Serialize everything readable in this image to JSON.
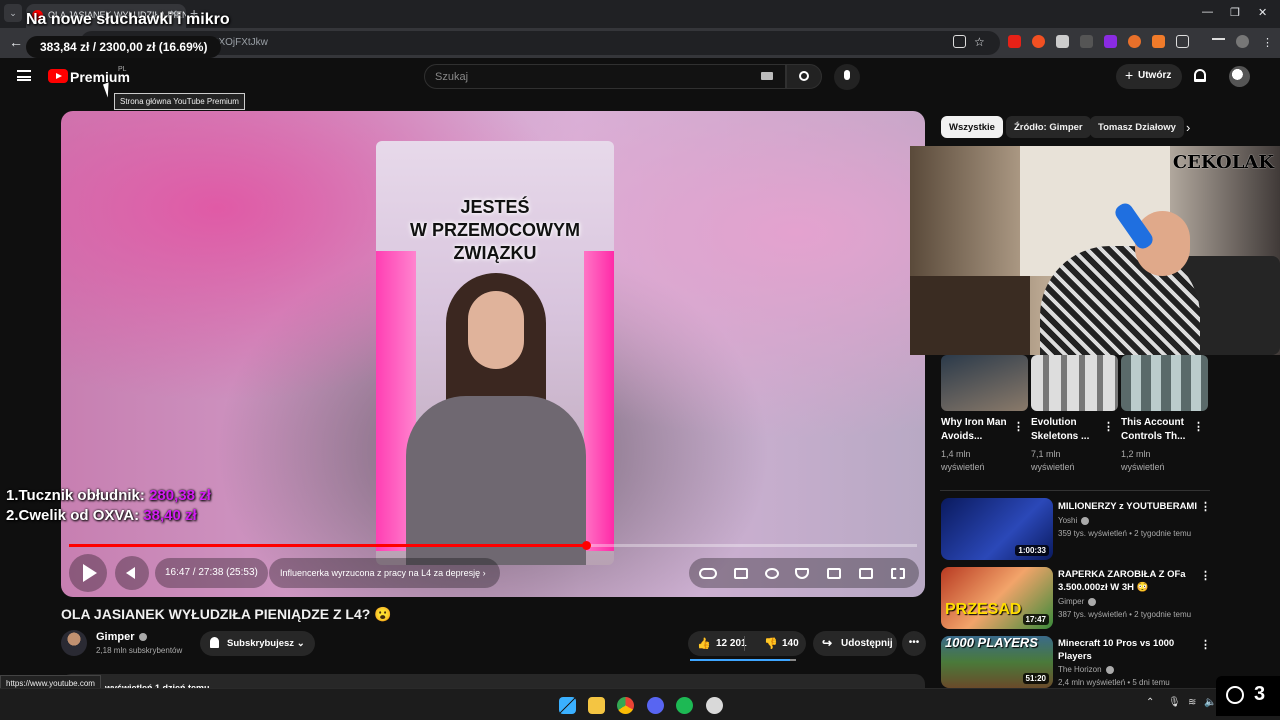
{
  "overlay": {
    "stream_title": "Na nowe słuchawki i mikro",
    "goal": "383,84 zł / 2300,00 zł (16.69%)",
    "goal_progress_percent": 16.69,
    "lines": [
      {
        "label": "1.Tucznik obłudnik:",
        "amount": "280,38 zł"
      },
      {
        "label": "2.Cwelik od OXVA:",
        "amount": "38,40 zł"
      }
    ],
    "viewers": "3",
    "webcam_logo": "CEKOLAK"
  },
  "browser": {
    "tab_title": "OLA JASIANEK WYŁUDZIŁA PIENIĄDZE",
    "url": "youtube.com/watch?v=...9XOjFXtJkw",
    "status_url": "https://www.youtube.com"
  },
  "header": {
    "logo": "Premium",
    "logo_region": "PL",
    "tooltip": "Strona główna YouTube Premium",
    "search_placeholder": "Szukaj",
    "create_label": "Utwórz"
  },
  "player": {
    "frame_text": "JESTEŚ\nW PRZEMOCOWYM\nZWIĄZKU",
    "time": "16:47 / 27:38 (25:53)",
    "chapter": "Influencerka wyrzucona z pracy na L4 za depresję",
    "progress_fraction": 0.61
  },
  "video": {
    "title": "OLA JASIANEK WYŁUDZIŁA PIENIĄDZE Z L4? 😮",
    "channel": "Gimper",
    "subscribers": "2,18 mln subskrybentów",
    "subscribe_label": "Subskrybujesz",
    "likes": "12 201",
    "dislikes": "140",
    "share_label": "Udostępnij",
    "description_preview": "wyświetleń  1 dzień temu"
  },
  "sidebar": {
    "chips": [
      "Wszystkie",
      "Źródło: Gimper",
      "Tomasz Działowy"
    ],
    "shorts": [
      {
        "title": "Why Iron Man Avoids...",
        "views": "1,4 mln wyświetleń"
      },
      {
        "title": "Evolution Skeletons ...",
        "views": "7,1 mln wyświetleń"
      },
      {
        "title": "This Account Controls Th...",
        "views": "1,2 mln wyświetleń"
      }
    ],
    "recommended": [
      {
        "title": "MILIONERZY z YOUTUBERAMI",
        "channel": "Yoshi",
        "meta": "359 tys. wyświetleń • 2 tygodnie temu",
        "duration": "1:00:33",
        "color": "#1a2a6e"
      },
      {
        "title": "RAPERKA ZAROBIŁA Z OFa 3.500.000zł W 3H 😳",
        "channel": "Gimper",
        "meta": "387 tys. wyświetleń • 2 tygodnie temu",
        "duration": "17:47",
        "color": "#c44a2e",
        "thumb_text": "PRZESAD"
      },
      {
        "title": "Minecraft 10 Pros vs 1000 Players",
        "channel": "The Horizon",
        "meta": "2,4 mln wyświetleń • 5 dni temu",
        "duration": "51:20",
        "color": "#4a7a3a",
        "thumb_text": "1000 PLAYERS"
      }
    ]
  }
}
